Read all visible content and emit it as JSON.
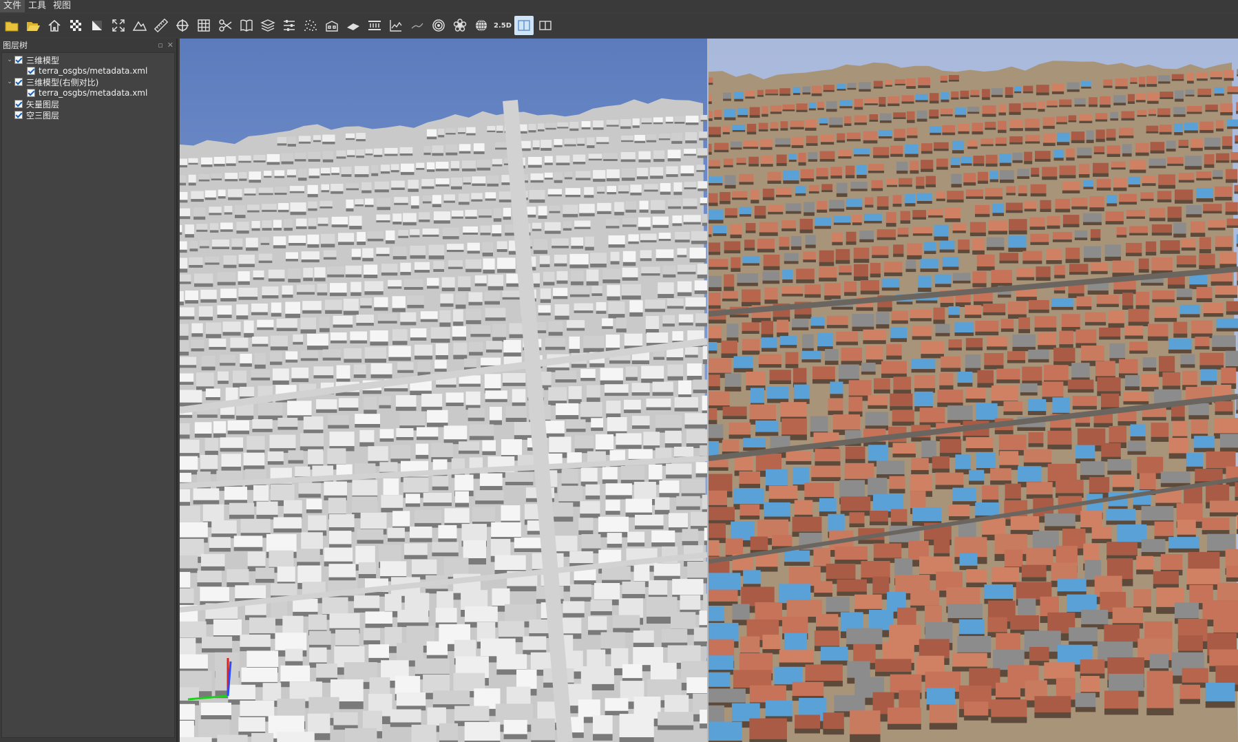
{
  "menu": {
    "file": "文件",
    "tools": "工具",
    "view": "视图"
  },
  "toolbar": {
    "buttons": [
      {
        "icon": "folder-icon"
      },
      {
        "icon": "open-folder-icon"
      },
      {
        "icon": "home-icon"
      },
      {
        "icon": "checkerboard-icon"
      },
      {
        "icon": "square-diagonal-icon"
      },
      {
        "icon": "fullscreen-icon"
      },
      {
        "icon": "terrain-icon"
      },
      {
        "icon": "ruler-icon"
      },
      {
        "icon": "crosshair-icon"
      },
      {
        "icon": "grid-icon"
      },
      {
        "icon": "scissors-icon"
      },
      {
        "icon": "book-icon"
      },
      {
        "icon": "layers-icon"
      },
      {
        "icon": "sliders-icon"
      },
      {
        "icon": "point-cloud-icon"
      },
      {
        "icon": "building-icon"
      },
      {
        "icon": "plane-icon"
      },
      {
        "icon": "section-icon"
      },
      {
        "icon": "profile-chart-icon"
      },
      {
        "icon": "line-icon"
      },
      {
        "icon": "target-icon"
      },
      {
        "icon": "settings-flower-icon"
      },
      {
        "icon": "globe-icon"
      },
      {
        "icon": "view-2-5d-icon",
        "label": "2.5D"
      },
      {
        "icon": "split-view-active-icon",
        "active": true
      },
      {
        "icon": "split-view-icon"
      }
    ]
  },
  "layer_panel": {
    "title": "图层树",
    "items": [
      {
        "label": "三维模型",
        "checked": true,
        "expanded": true,
        "level": 0
      },
      {
        "label": "terra_osgbs/metadata.xml",
        "checked": true,
        "level": 1
      },
      {
        "label": "三维模型(右侧对比)",
        "checked": true,
        "expanded": true,
        "level": 0
      },
      {
        "label": "terra_osgbs/metadata.xml",
        "checked": true,
        "level": 1
      },
      {
        "label": "矢量图层",
        "checked": true,
        "level": 0
      },
      {
        "label": "空三图层",
        "checked": true,
        "level": 0
      }
    ]
  },
  "colors": {
    "background": "#3c3c3c",
    "panel": "#434343",
    "active_button": "#cfe4f7",
    "check_mark": "#1a5fb4"
  }
}
